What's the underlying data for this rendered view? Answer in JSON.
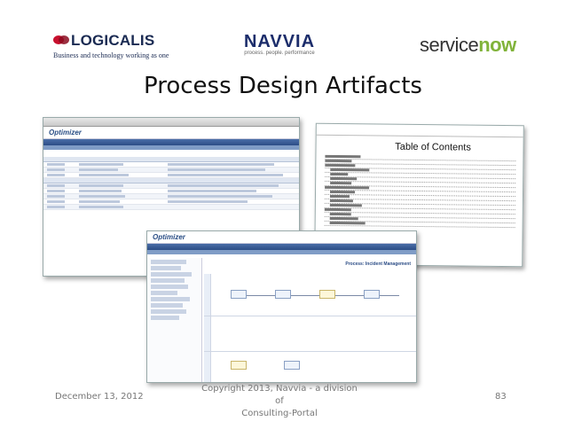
{
  "logos": {
    "logicalis": {
      "name": "LOGICALIS",
      "tagline": "Business and technology working as one"
    },
    "navvia": {
      "name": "NAVVIA",
      "tagline": "process. people. performance"
    },
    "servicenow": {
      "prefix": "service",
      "suffix": "now"
    },
    "colors": {
      "logicalis": "#1a2a52",
      "navvia": "#1c2d6b",
      "servicenow_accent": "#81b33a"
    }
  },
  "title": "Process Design Artifacts",
  "screenshots": {
    "app_brand": "Optimizer",
    "doc_heading": "Table of Contents",
    "process_heading": "Process: Incident Management"
  },
  "footer": {
    "date": "December 13, 2012",
    "copyright_line1": "Copyright 2013, Navvia - a division of",
    "copyright_line2": "Consulting-Portal",
    "page_number": "83"
  }
}
